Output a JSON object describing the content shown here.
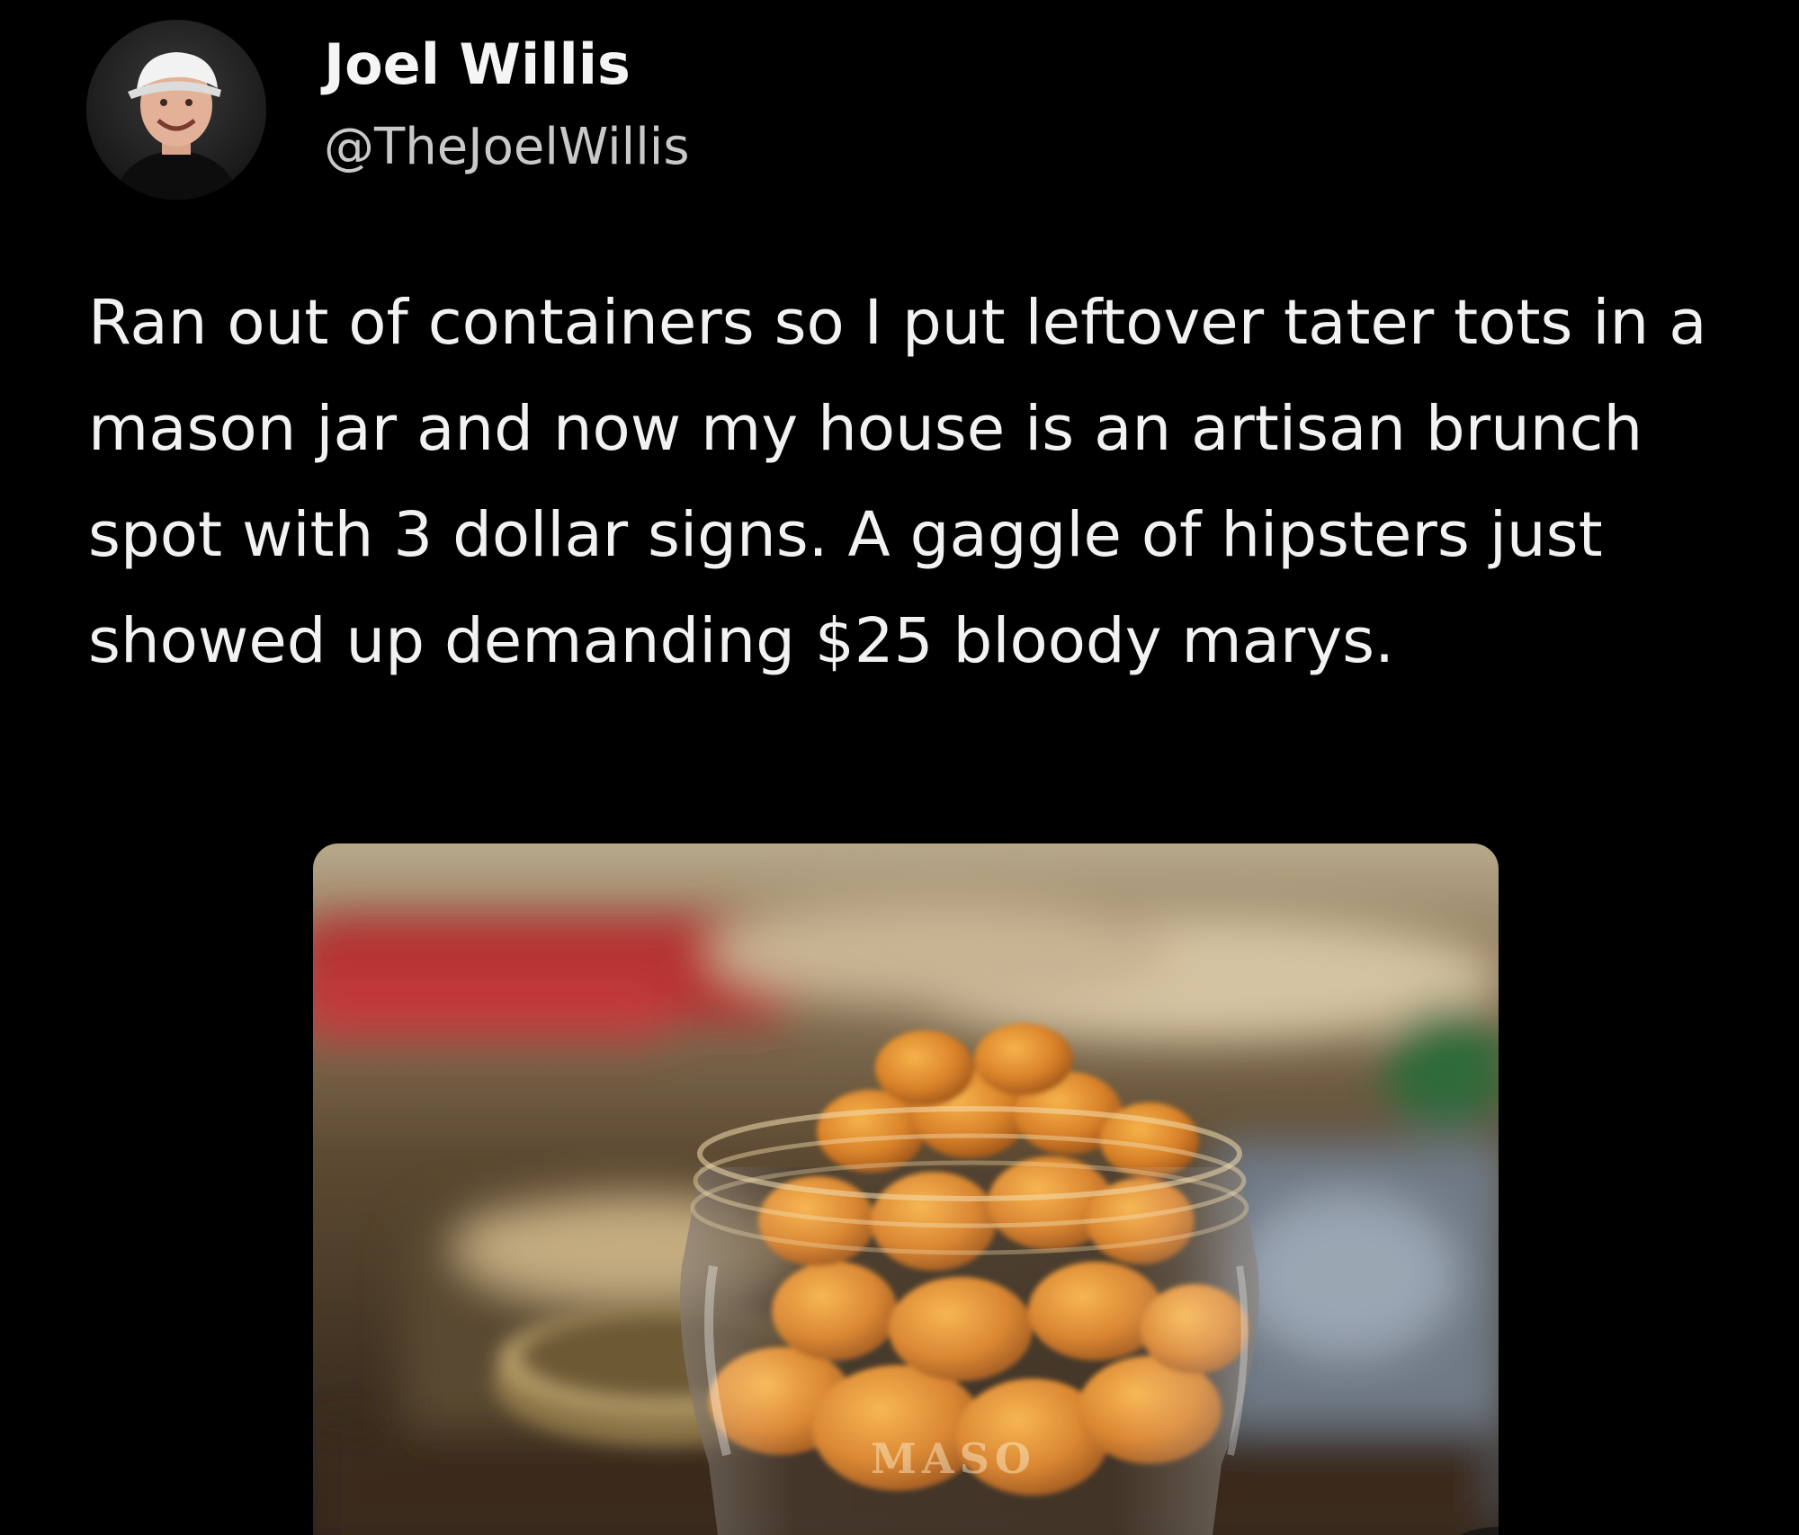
{
  "author": {
    "display_name": "Joel Willis",
    "handle": "@TheJoelWillis",
    "avatar_icon": "avatar-photo"
  },
  "post": {
    "text": "Ran out of containers so I put leftover tater tots in a mason jar and now my house is an artisan brunch spot with 3 dollar signs. A gaggle of hipsters just showed up demanding $25 bloody marys."
  },
  "media": {
    "jar_embossing": "MASO"
  },
  "colors": {
    "background": "#000000",
    "name_text": "#f5f5f5",
    "handle_text": "#c9c9c9",
    "body_text": "#f2f2f2"
  }
}
